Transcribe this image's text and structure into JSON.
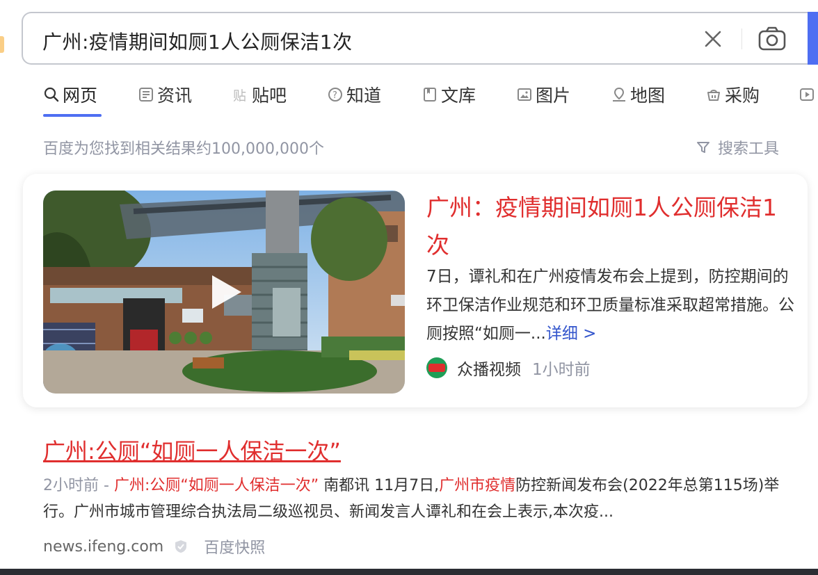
{
  "search": {
    "query": "广州:疫情期间如厕1人公厕保洁1次"
  },
  "tabs": [
    {
      "label": "网页",
      "icon": "search-icon"
    },
    {
      "label": "资讯",
      "icon": "news-icon"
    },
    {
      "label": "贴吧",
      "icon": "tieba-icon"
    },
    {
      "label": "知道",
      "icon": "question-icon"
    },
    {
      "label": "文库",
      "icon": "document-icon"
    },
    {
      "label": "图片",
      "icon": "image-icon"
    },
    {
      "label": "地图",
      "icon": "map-pin-icon"
    },
    {
      "label": "采购",
      "icon": "basket-icon"
    }
  ],
  "results_info": {
    "count_text": "百度为您找到相关结果约100,000,000个",
    "tools_label": "搜索工具"
  },
  "card": {
    "title": "广州：疫情期间如厕1人公厕保洁1次",
    "summary": "7日，谭礼和在广州疫情发布会上提到，防控期间的环卫保洁作业规范和环卫质量标准采取超常措施。公厕按照“如厕一...",
    "more_label": "详细 >",
    "source_name": "众播视频",
    "source_time": "1小时前"
  },
  "result2": {
    "title": "广州:公厕“如厕一人保洁一次”",
    "time": "2小时前 - ",
    "hl1": "广州:公厕“如厕一人保洁一次”",
    "text1": " 南都讯 11月7日,",
    "hl2": "广州市疫情",
    "text2": "防控新闻发布会(2022年总第115场)举行。广州市城市管理综合执法局二级巡视员、新闻发言人谭礼和在会上表示,本次疫...",
    "domain": "news.ifeng.com",
    "snapshot_label": "百度快照"
  },
  "colors": {
    "accent": "#4e6ef2",
    "title_red": "#e02e2e",
    "muted": "#9195a3"
  }
}
